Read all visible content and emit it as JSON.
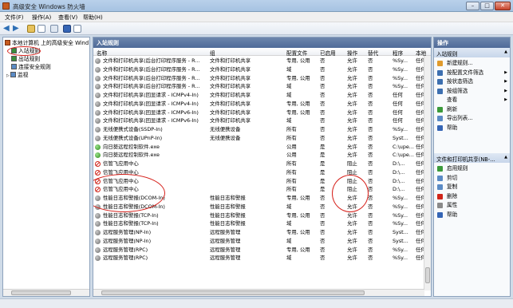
{
  "window": {
    "title": "高级安全 Windows 防火墙"
  },
  "menu": [
    "文件(F)",
    "操作(A)",
    "查看(V)",
    "帮助(H)"
  ],
  "tree": {
    "root": "本地计算机 上的高级安全 Wind",
    "items": [
      "入站规则",
      "出站规则",
      "连接安全规则",
      "监视"
    ]
  },
  "center": {
    "title": "入站规则",
    "columns": [
      "名称",
      "组",
      "配置文件",
      "已启用",
      "操作",
      "替代",
      "程序",
      "本地"
    ],
    "rows": [
      {
        "icon": "gray",
        "name": "文件和打印机共享(后台打印程序服务 - R...",
        "group": "文件和打印机共享",
        "profile": "专用, 公用",
        "enabled": "否",
        "action": "允许",
        "override": "否",
        "program": "%Sy...",
        "local": "任何"
      },
      {
        "icon": "gray",
        "name": "文件和打印机共享(后台打印程序服务 - R...",
        "group": "文件和打印机共享",
        "profile": "域",
        "enabled": "否",
        "action": "允许",
        "override": "否",
        "program": "%Sy...",
        "local": "任何"
      },
      {
        "icon": "gray",
        "name": "文件和打印机共享(后台打印程序服务 - R...",
        "group": "文件和打印机共享",
        "profile": "专用, 公用",
        "enabled": "否",
        "action": "允许",
        "override": "否",
        "program": "%Sy...",
        "local": "任何"
      },
      {
        "icon": "gray",
        "name": "文件和打印机共享(后台打印程序服务 - R...",
        "group": "文件和打印机共享",
        "profile": "域",
        "enabled": "否",
        "action": "允许",
        "override": "否",
        "program": "%Sy...",
        "local": "任何"
      },
      {
        "icon": "gray",
        "name": "文件和打印机共享(回显请求 - ICMPv4-In)",
        "group": "文件和打印机共享",
        "profile": "域",
        "enabled": "否",
        "action": "允许",
        "override": "否",
        "program": "任何",
        "local": "任何"
      },
      {
        "icon": "gray",
        "name": "文件和打印机共享(回显请求 - ICMPv4-In)",
        "group": "文件和打印机共享",
        "profile": "专用, 公用",
        "enabled": "否",
        "action": "允许",
        "override": "否",
        "program": "任何",
        "local": "任何"
      },
      {
        "icon": "gray",
        "name": "文件和打印机共享(回显请求 - ICMPv6-In)",
        "group": "文件和打印机共享",
        "profile": "专用, 公用",
        "enabled": "否",
        "action": "允许",
        "override": "否",
        "program": "任何",
        "local": "任何"
      },
      {
        "icon": "gray",
        "name": "文件和打印机共享(回显请求 - ICMPv6-In)",
        "group": "文件和打印机共享",
        "profile": "域",
        "enabled": "否",
        "action": "允许",
        "override": "否",
        "program": "任何",
        "local": "任何"
      },
      {
        "icon": "gray",
        "name": "无线便携式设备(SSDP-In)",
        "group": "无线便携设备",
        "profile": "所有",
        "enabled": "否",
        "action": "允许",
        "override": "否",
        "program": "%Sy...",
        "local": "任何"
      },
      {
        "icon": "gray",
        "name": "无线便携式设备(UPnP-In)",
        "group": "无线便携设备",
        "profile": "所有",
        "enabled": "否",
        "action": "允许",
        "override": "否",
        "program": "Syst...",
        "local": "任何"
      },
      {
        "icon": "green",
        "name": "向日葵远程控制软件.exe",
        "group": "",
        "profile": "公用",
        "enabled": "是",
        "action": "允许",
        "override": "否",
        "program": "C:\\upe...",
        "local": "任何"
      },
      {
        "icon": "green",
        "name": "向日葵远程控制软件.exe",
        "group": "",
        "profile": "公用",
        "enabled": "是",
        "action": "允许",
        "override": "否",
        "program": "C:\\upe...",
        "local": "任何"
      },
      {
        "icon": "block",
        "name": "信管飞应用中心",
        "group": "",
        "profile": "所有",
        "enabled": "是",
        "action": "阻止",
        "override": "否",
        "program": "D:\\...",
        "local": "任何"
      },
      {
        "icon": "block",
        "name": "信管飞应用中心",
        "group": "",
        "profile": "所有",
        "enabled": "是",
        "action": "阻止",
        "override": "否",
        "program": "D:\\...",
        "local": "任何"
      },
      {
        "icon": "block",
        "name": "信管飞应用中心",
        "group": "",
        "profile": "所有",
        "enabled": "是",
        "action": "阻止",
        "override": "否",
        "program": "D:\\...",
        "local": "任何"
      },
      {
        "icon": "block",
        "name": "信管飞应用中心",
        "group": "",
        "profile": "所有",
        "enabled": "是",
        "action": "阻止",
        "override": "否",
        "program": "D:\\...",
        "local": "任何"
      },
      {
        "icon": "gray",
        "name": "性能日志和警报(DCOM-In)",
        "group": "性能日志和警报",
        "profile": "专用, 公用",
        "enabled": "否",
        "action": "允许",
        "override": "否",
        "program": "%Sy...",
        "local": "任何"
      },
      {
        "icon": "gray",
        "name": "性能日志和警报(DCOM-In)",
        "group": "性能日志和警报",
        "profile": "域",
        "enabled": "否",
        "action": "允许",
        "override": "否",
        "program": "%Sy...",
        "local": "任何"
      },
      {
        "icon": "gray",
        "name": "性能日志和警报(TCP-In)",
        "group": "性能日志和警报",
        "profile": "专用, 公用",
        "enabled": "否",
        "action": "允许",
        "override": "否",
        "program": "%Sy...",
        "local": "任何"
      },
      {
        "icon": "gray",
        "name": "性能日志和警报(TCP-In)",
        "group": "性能日志和警报",
        "profile": "域",
        "enabled": "否",
        "action": "允许",
        "override": "否",
        "program": "%Sy...",
        "local": "任何"
      },
      {
        "icon": "gray",
        "name": "远程服务管理(NP-In)",
        "group": "远程服务管理",
        "profile": "专用, 公用",
        "enabled": "否",
        "action": "允许",
        "override": "否",
        "program": "Syst...",
        "local": "任何"
      },
      {
        "icon": "gray",
        "name": "远程服务管理(NP-In)",
        "group": "远程服务管理",
        "profile": "域",
        "enabled": "否",
        "action": "允许",
        "override": "否",
        "program": "Syst...",
        "local": "任何"
      },
      {
        "icon": "gray",
        "name": "远程服务管理(RPC)",
        "group": "远程服务管理",
        "profile": "专用, 公用",
        "enabled": "否",
        "action": "允许",
        "override": "否",
        "program": "%Sy...",
        "local": "任何"
      },
      {
        "icon": "gray",
        "name": "远程服务管理(RPC)",
        "group": "远程服务管理",
        "profile": "域",
        "enabled": "否",
        "action": "允许",
        "override": "否",
        "program": "%Sy...",
        "local": "任何"
      }
    ]
  },
  "actions": {
    "header": "操作",
    "section1": "入站规则",
    "items1": [
      {
        "label": "新建规则...",
        "color": "#e09b2d",
        "submenu": false
      },
      {
        "label": "按配置文件筛选",
        "color": "#3c6fb0",
        "submenu": true
      },
      {
        "label": "按状态筛选",
        "color": "#3c6fb0",
        "submenu": true
      },
      {
        "label": "按组筛选",
        "color": "#3c6fb0",
        "submenu": true
      },
      {
        "label": "查看",
        "color": "#f8fafc",
        "submenu": true
      },
      {
        "label": "刷新",
        "color": "#3b9a3b",
        "submenu": false
      },
      {
        "label": "导出列表...",
        "color": "#5b8bc5",
        "submenu": false
      },
      {
        "label": "帮助",
        "color": "#3565b5",
        "submenu": false
      }
    ],
    "section2": "文件和打印机共享(NB-...",
    "items2": [
      {
        "label": "启用规则",
        "color": "#3b9a3b"
      },
      {
        "label": "剪切",
        "color": "#5b8bc5"
      },
      {
        "label": "复制",
        "color": "#5b8bc5"
      },
      {
        "label": "删除",
        "color": "#d0251a"
      },
      {
        "label": "属性",
        "color": "#8a8a8a"
      },
      {
        "label": "帮助",
        "color": "#3565b5"
      }
    ]
  }
}
